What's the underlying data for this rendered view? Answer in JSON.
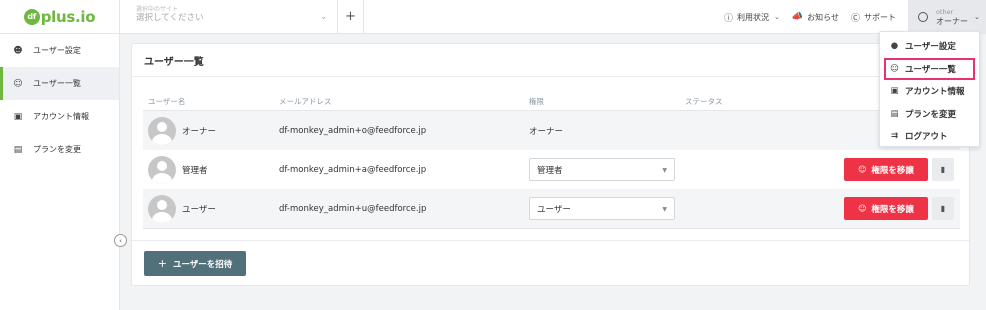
{
  "header": {
    "logo_badge": "df",
    "logo_text": "plus.io",
    "site_select": {
      "label": "選択中のサイト",
      "value": "選択してください"
    },
    "add_label": "+",
    "nav": [
      {
        "icon": "info-circle-icon",
        "label": "利用状況",
        "has_chevron": true
      },
      {
        "icon": "megaphone-icon",
        "label": "お知らせ",
        "has_chevron": false
      },
      {
        "icon": "question-circle-icon",
        "label": "サポート",
        "has_chevron": false
      }
    ],
    "user": {
      "top": "other",
      "name": "オーナー"
    }
  },
  "sidebar": {
    "items": [
      {
        "icon": "user-icon",
        "label": "ユーザー設定",
        "active": false
      },
      {
        "icon": "users-icon",
        "label": "ユーザー一覧",
        "active": true
      },
      {
        "icon": "id-card-icon",
        "label": "アカウント情報",
        "active": false
      },
      {
        "icon": "credit-card-icon",
        "label": "プランを変更",
        "active": false
      }
    ]
  },
  "main": {
    "title": "ユーザー一覧",
    "columns": [
      "ユーザー名",
      "メールアドレス",
      "権限",
      "ステータス"
    ],
    "rows": [
      {
        "name": "オーナー",
        "email": "df-monkey_admin+o@feedforce.jp",
        "role": "オーナー",
        "role_editable": false
      },
      {
        "name": "管理者",
        "email": "df-monkey_admin+a@feedforce.jp",
        "role": "管理者",
        "role_editable": true,
        "transfer_label": "権限を移譲"
      },
      {
        "name": "ユーザー",
        "email": "df-monkey_admin+u@feedforce.jp",
        "role": "ユーザー",
        "role_editable": true,
        "transfer_label": "権限を移譲"
      }
    ],
    "invite_label": "ユーザーを招待"
  },
  "user_menu": {
    "items": [
      {
        "icon": "user-icon",
        "label": "ユーザー設定",
        "active": false
      },
      {
        "icon": "users-icon",
        "label": "ユーザー一覧",
        "active": true
      },
      {
        "icon": "id-card-icon",
        "label": "アカウント情報",
        "active": false
      },
      {
        "icon": "credit-card-icon",
        "label": "プランを変更",
        "active": false
      },
      {
        "icon": "logout-icon",
        "label": "ログアウト",
        "active": false
      }
    ]
  },
  "colors": {
    "brand": "#6fb83f",
    "danger": "#ef3347",
    "invite": "#52707a",
    "highlight": "#e8336d"
  }
}
